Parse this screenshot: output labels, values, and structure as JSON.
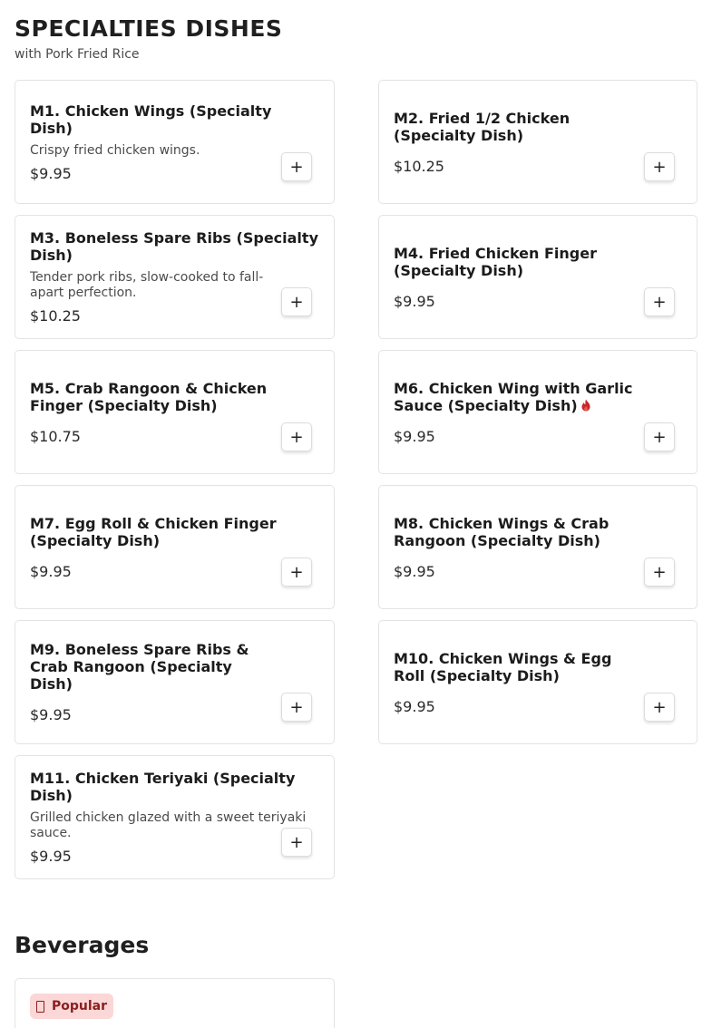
{
  "section": {
    "title": "SPECIALTIES DISHES",
    "subtitle": "with Pork Fried Rice"
  },
  "items": [
    {
      "name": "M1. Chicken Wings (Specialty Dish)",
      "description": "Crispy fried chicken wings.",
      "price": "$9.95",
      "add_label": "+"
    },
    {
      "name": "M2. Fried 1/2 Chicken (Specialty Dish)",
      "description": "",
      "price": "$10.25",
      "add_label": "+"
    },
    {
      "name": "M3. Boneless Spare Ribs (Specialty Dish)",
      "description": "Tender pork ribs, slow-cooked to fall-apart perfection.",
      "price": "$10.25",
      "add_label": "+"
    },
    {
      "name": "M4. Fried Chicken Finger (Specialty Dish)",
      "description": "",
      "price": "$9.95",
      "add_label": "+"
    },
    {
      "name": "M5. Crab Rangoon & Chicken Finger (Specialty Dish)",
      "description": "",
      "price": "$10.75",
      "add_label": "+"
    },
    {
      "name": "M6. Chicken Wing with Garlic Sauce (Specialty Dish)",
      "description": "",
      "price": "$9.95",
      "add_label": "+",
      "spicy_icon": "flame-icon"
    },
    {
      "name": "M7. Egg Roll & Chicken Finger (Specialty Dish)",
      "description": "",
      "price": "$9.95",
      "add_label": "+"
    },
    {
      "name": "M8. Chicken Wings & Crab Rangoon (Specialty Dish)",
      "description": "",
      "price": "$9.95",
      "add_label": "+"
    },
    {
      "name": "M9. Boneless Spare Ribs & Crab Rangoon (Specialty Dish)",
      "description": "",
      "price": "$9.95",
      "add_label": "+"
    },
    {
      "name": "M10. Chicken Wings & Egg Roll (Specialty Dish)",
      "description": "",
      "price": "$9.95",
      "add_label": "+"
    },
    {
      "name": "M11. Chicken Teriyaki (Specialty Dish)",
      "description": "Grilled chicken glazed with a sweet teriyaki sauce.",
      "price": "$9.95",
      "add_label": "+"
    }
  ],
  "beverages": {
    "title": "Beverages",
    "badge": "Popular",
    "badge_icon": "popular-icon"
  },
  "colors": {
    "badge_bg": "#fbd7d7",
    "badge_text": "#8b1e1e",
    "spicy": "#c62828"
  }
}
